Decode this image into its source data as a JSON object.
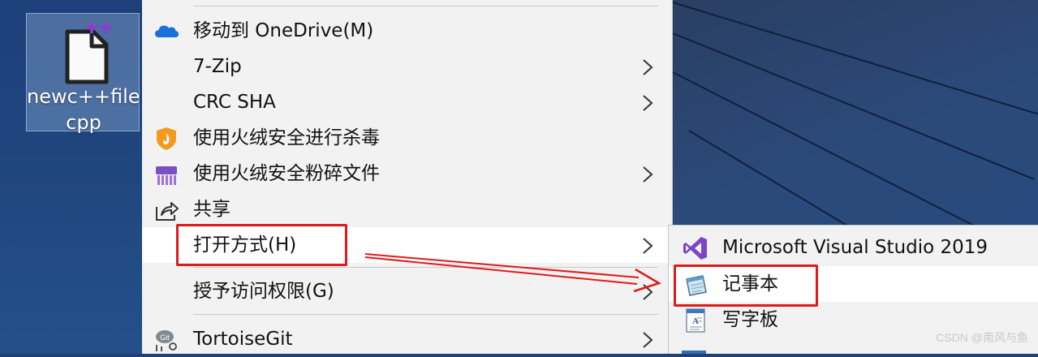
{
  "desktop": {
    "file": {
      "name_line1": "newc++file.",
      "name_line2": "cpp",
      "icon": "cpp-file-icon"
    }
  },
  "context_menu": {
    "items": [
      {
        "label": "移动到 OneDrive(M)",
        "icon": "onedrive-icon",
        "submenu": false
      },
      {
        "label": "7-Zip",
        "icon": "",
        "submenu": true
      },
      {
        "label": "CRC SHA",
        "icon": "",
        "submenu": true
      },
      {
        "label": "使用火绒安全进行杀毒",
        "icon": "huorong-shield-icon",
        "submenu": false
      },
      {
        "label": "使用火绒安全粉碎文件",
        "icon": "huorong-shredder-icon",
        "submenu": true
      },
      {
        "label": "共享",
        "icon": "share-icon",
        "submenu": false
      },
      {
        "label": "打开方式(H)",
        "icon": "",
        "submenu": true,
        "highlighted": true
      },
      {
        "label": "授予访问权限(G)",
        "icon": "",
        "submenu": true
      },
      {
        "label": "TortoiseGit",
        "icon": "tortoisegit-icon",
        "submenu": true
      }
    ]
  },
  "open_with_submenu": {
    "items": [
      {
        "label": "Microsoft Visual Studio 2019",
        "icon": "visual-studio-icon"
      },
      {
        "label": "记事本",
        "icon": "notepad-icon",
        "highlighted": true
      },
      {
        "label": "写字板",
        "icon": "wordpad-icon"
      }
    ]
  },
  "annotations": {
    "color": "#e01a1a",
    "boxes": [
      "打开方式(H)",
      "记事本"
    ],
    "arrow": "from 打开方式(H) to 记事本"
  },
  "watermark": "CSDN @南风与鱼",
  "colors": {
    "menu_bg": "#f2f2f2",
    "highlight_bg": "#ffffff",
    "annotation_red": "#e01a1a",
    "desktop_blue": "#1f3f75"
  }
}
